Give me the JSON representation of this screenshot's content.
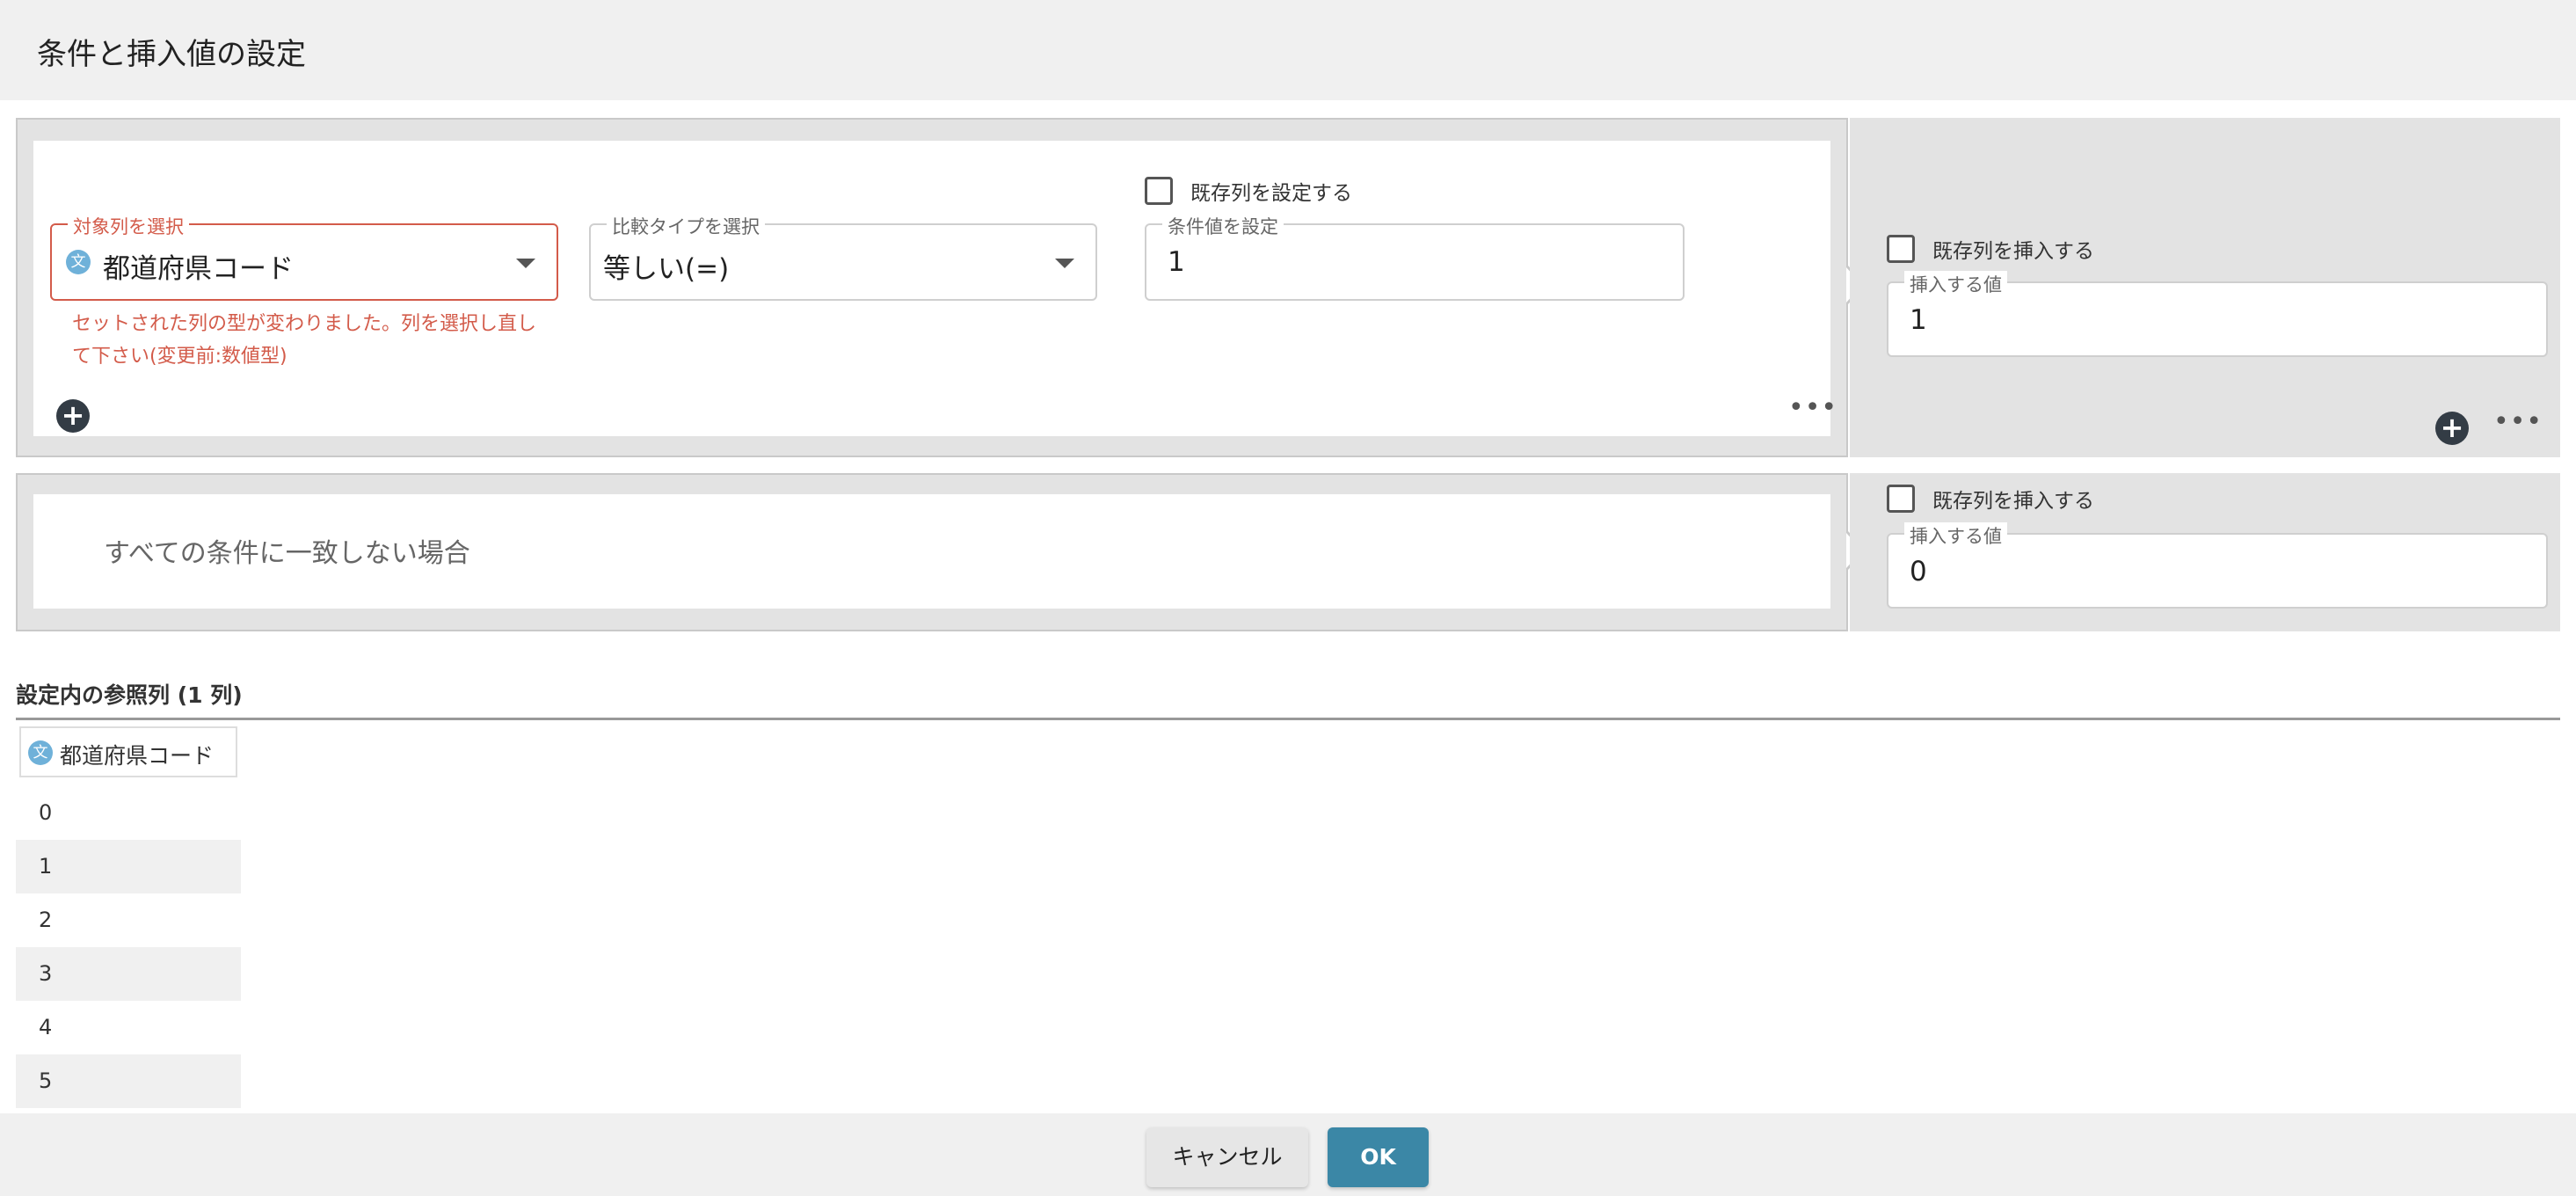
{
  "dialog": {
    "title": "条件と挿入値の設定"
  },
  "rule1": {
    "target_column": {
      "legend": "対象列を選択",
      "value": "都道府県コード",
      "type_icon": "文"
    },
    "error_line1": "セットされた列の型が変わりました。列を選択し直し",
    "error_line2": "て下さい(変更前:数値型)",
    "compare_type": {
      "legend": "比較タイプを選択",
      "value": "等しい(=)"
    },
    "set_existing_column_label": "既存列を設定する",
    "condition_value": {
      "legend": "条件値を設定",
      "value": "1"
    },
    "insert_existing_label": "既存列を挿入する",
    "insert_value": {
      "legend": "挿入する値",
      "value": "1"
    }
  },
  "else_rule": {
    "label": "すべての条件に一致しない場合",
    "insert_existing_label": "既存列を挿入する",
    "insert_value": {
      "legend": "挿入する値",
      "value": "0"
    }
  },
  "reference": {
    "title": "設定内の参照列 (1 列)",
    "column_name": "都道府県コード",
    "type_icon": "文",
    "rows": [
      "0",
      "1",
      "2",
      "3",
      "4",
      "5"
    ]
  },
  "footer": {
    "cancel_label": "キャンセル",
    "ok_label": "OK"
  },
  "colors": {
    "error": "#d35b4a",
    "primary": "#3b87a6",
    "type_icon": "#6fb1d9"
  }
}
